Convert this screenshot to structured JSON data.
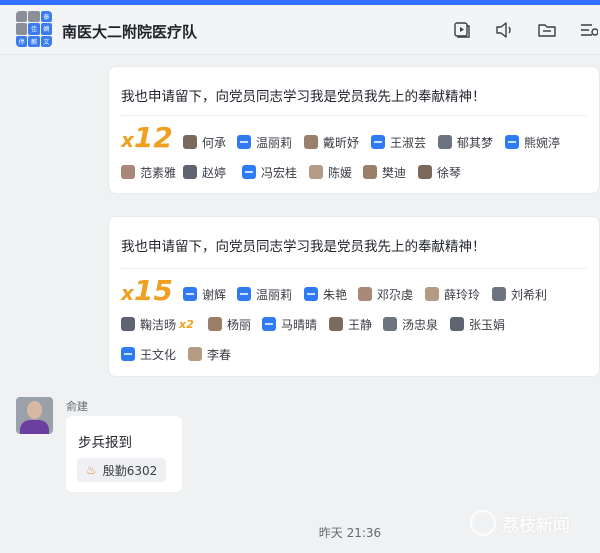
{
  "header": {
    "title": "南医大二附院医疗队",
    "avatar_cells": [
      "",
      "",
      "泰",
      "",
      "佳",
      "嫡",
      "停",
      "麒",
      "文"
    ]
  },
  "cards": [
    {
      "text": "我也申请留下，向党员同志学习我是党员我先上的奉献精神！",
      "count_prefix": "x",
      "count": "12",
      "names": [
        {
          "name": "何承",
          "avatar": "photo"
        },
        {
          "name": "温丽莉",
          "avatar": "blue"
        },
        {
          "name": "戴昕妤",
          "avatar": "photo"
        },
        {
          "name": "王淑芸",
          "avatar": "blue"
        },
        {
          "name": "郁其梦",
          "avatar": "photo"
        },
        {
          "name": "熊婉渟",
          "avatar": "blue"
        },
        {
          "name": "范素雅",
          "avatar": "photo"
        },
        {
          "name": "赵婷",
          "avatar": "photo"
        },
        {
          "name": "冯宏桂",
          "avatar": "blue"
        },
        {
          "name": "陈媛",
          "avatar": "photo"
        },
        {
          "name": "樊迪",
          "avatar": "photo"
        },
        {
          "name": "徐琴",
          "avatar": "photo"
        }
      ]
    },
    {
      "text": "我也申请留下，向党员同志学习我是党员我先上的奉献精神！",
      "count_prefix": "x",
      "count": "15",
      "names": [
        {
          "name": "谢辉",
          "avatar": "blue"
        },
        {
          "name": "温丽莉",
          "avatar": "blue"
        },
        {
          "name": "朱艳",
          "avatar": "blue"
        },
        {
          "name": "邓尕虔",
          "avatar": "photo"
        },
        {
          "name": "薛玲玲",
          "avatar": "photo"
        },
        {
          "name": "刘希利",
          "avatar": "photo"
        },
        {
          "name": "鞠洁旸",
          "avatar": "photo",
          "multiplier": "x2"
        },
        {
          "name": "杨丽",
          "avatar": "photo"
        },
        {
          "name": "马晴晴",
          "avatar": "blue"
        },
        {
          "name": "王静",
          "avatar": "photo"
        },
        {
          "name": "汤忠泉",
          "avatar": "photo"
        },
        {
          "name": "张玉娟",
          "avatar": "photo"
        },
        {
          "name": "王文化",
          "avatar": "blue"
        },
        {
          "name": "李春",
          "avatar": "photo"
        }
      ]
    }
  ],
  "message": {
    "sender": "俞建",
    "text": "步兵报到",
    "reaction_label": "殷勤6302"
  },
  "timestamp": "昨天 21:36",
  "watermark": "荔枝新闻",
  "icons": [
    "video-call-icon",
    "announcement-icon",
    "folder-icon",
    "more-icon"
  ],
  "colors": {
    "accent": "#3370ff",
    "count": "#f0a020",
    "blue_avatar": "#2f7bf5"
  }
}
